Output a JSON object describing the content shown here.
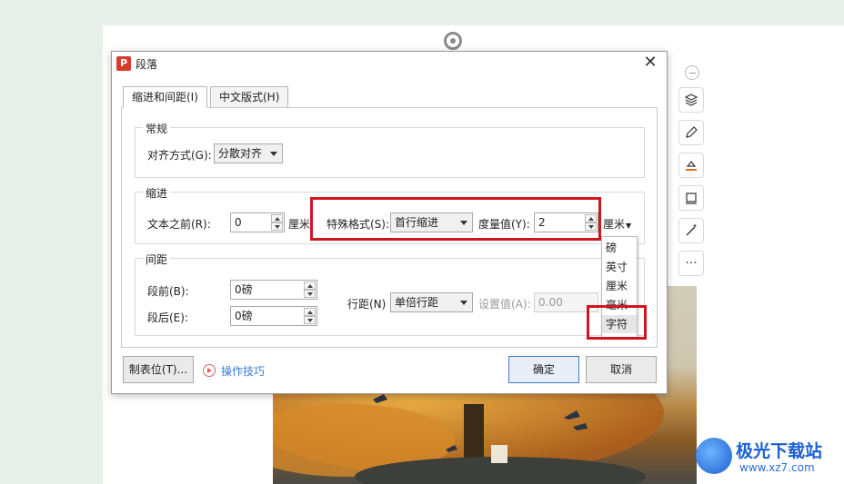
{
  "dialog": {
    "title": "段落",
    "logo_letter": "P",
    "close_glyph": "✕"
  },
  "tabs": [
    {
      "label": "缩进和间距(I)",
      "active": true
    },
    {
      "label": "中文版式(H)",
      "active": false
    }
  ],
  "general": {
    "title": "常规",
    "alignment_label": "对齐方式(G):",
    "alignment_value": "分散对齐"
  },
  "indent": {
    "title": "缩进",
    "before_text_label": "文本之前(R):",
    "before_text_value": "0",
    "before_text_unit": "厘米",
    "special_label": "特殊格式(S):",
    "special_value": "首行缩进",
    "measure_label": "度量值(Y):",
    "measure_value": "2",
    "measure_unit": "厘米"
  },
  "unit_menu": {
    "items": [
      "磅",
      "英寸",
      "厘米",
      "毫米",
      "字符"
    ],
    "highlighted": "字符"
  },
  "spacing": {
    "title": "间距",
    "before_label": "段前(B):",
    "before_value": "0磅",
    "after_label": "段后(E):",
    "after_value": "0磅",
    "line_label": "行距(N)",
    "line_value": "单倍行距",
    "set_label": "设置值(A):",
    "set_value": "0.00"
  },
  "footer": {
    "tab_stops_label": "制表位(T)...",
    "tips_label": "操作技巧",
    "ok_label": "确定",
    "cancel_label": "取消"
  },
  "watermark": {
    "name": "极光下载站",
    "url": "www.xz7.com"
  },
  "side_toolbar": {
    "more_glyph": "···"
  }
}
